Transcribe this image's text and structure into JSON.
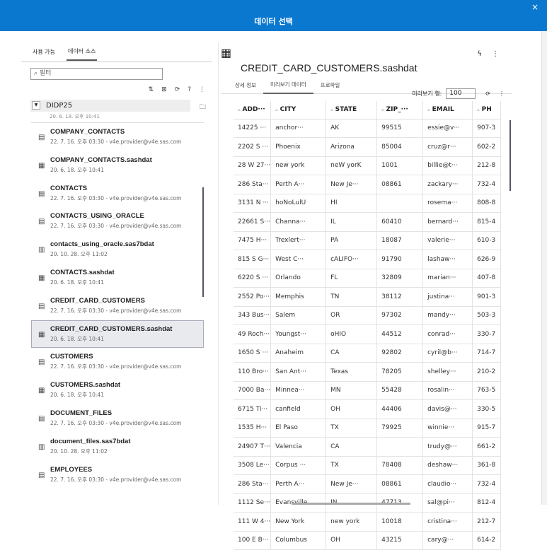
{
  "dialog": {
    "title": "데이터 선택",
    "close": "×"
  },
  "left": {
    "tabs": [
      "사용 가능",
      "데이터 소스"
    ],
    "filter_placeholder": "⌕ 필터",
    "tool_icons": [
      "⇅",
      "⊠",
      "⟳",
      "?",
      "⋮"
    ],
    "library": "DIDP25",
    "cut_item": "20. 6. 18. 오후 10:41",
    "items": [
      {
        "name": "COMPANY_CONTACTS",
        "sub": "22. 7. 16. 오후 03:30 - v4e.provider@v4e.sas.com",
        "icon": "table"
      },
      {
        "name": "COMPANY_CONTACTS.sashdat",
        "sub": "20. 6. 18. 오후 10:41",
        "icon": "file"
      },
      {
        "name": "CONTACTS",
        "sub": "22. 7. 16. 오후 03:30 - v4e.provider@v4e.sas.com",
        "icon": "table"
      },
      {
        "name": "CONTACTS_USING_ORACLE",
        "sub": "22. 7. 16. 오후 03:30 - v4e.provider@v4e.sas.com",
        "icon": "table"
      },
      {
        "name": "contacts_using_oracle.sas7bdat",
        "sub": "20. 10. 28. 오후 11:02",
        "icon": "grid"
      },
      {
        "name": "CONTACTS.sashdat",
        "sub": "20. 6. 18. 오후 10:41",
        "icon": "file"
      },
      {
        "name": "CREDIT_CARD_CUSTOMERS",
        "sub": "22. 7. 16. 오후 03:30 - v4e.provider@v4e.sas.com",
        "icon": "table"
      },
      {
        "name": "CREDIT_CARD_CUSTOMERS.sashdat",
        "sub": "20. 6. 18. 오후 10:41",
        "icon": "file"
      },
      {
        "name": "CUSTOMERS",
        "sub": "22. 7. 16. 오후 03:30 - v4e.provider@v4e.sas.com",
        "icon": "table"
      },
      {
        "name": "CUSTOMERS.sashdat",
        "sub": "20. 6. 18. 오후 10:41",
        "icon": "file"
      },
      {
        "name": "DOCUMENT_FILES",
        "sub": "22. 7. 16. 오후 03:30 - v4e.provider@v4e.sas.com",
        "icon": "table"
      },
      {
        "name": "document_files.sas7bdat",
        "sub": "20. 10. 28. 오후 11:02",
        "icon": "grid"
      },
      {
        "name": "EMPLOYEES",
        "sub": "22. 7. 16. 오후 03:30 - v4e.provider@v4e.sas.com",
        "icon": "table"
      }
    ],
    "selected_index": 7
  },
  "right": {
    "title": "CREDIT_CARD_CUSTOMERS.sashdat",
    "tabs": [
      "상세 정보",
      "미리보기 데이터",
      "프로파일"
    ],
    "active_tab": 1,
    "preview_label": "미리보기 행:",
    "preview_rows": "100",
    "columns": [
      "ADD···",
      "CITY",
      "STATE",
      "ZIP_···",
      "EMAIL",
      "PH"
    ],
    "rows": [
      [
        "14225 ···",
        "anchor···",
        "AK",
        "99515",
        "essie@v···",
        "907-3"
      ],
      [
        "2202 S ···",
        "Phoenix",
        "Arizona",
        "85004",
        "cruz@r···",
        "602-2"
      ],
      [
        "28 W 27···",
        "new york",
        "neW yorK",
        "1001",
        "billie@t···",
        "212-8"
      ],
      [
        "286 Sta···",
        "Perth A···",
        "New Je···",
        "08861",
        "zackary···",
        "732-4"
      ],
      [
        "3131 N ···",
        "hoNoLulU",
        "HI",
        "",
        "rosema···",
        "808-8"
      ],
      [
        "22661 S···",
        "Channa···",
        "IL",
        "60410",
        "bernard···",
        "815-4"
      ],
      [
        "7475 H···",
        "Trexlert···",
        "PA",
        "18087",
        "valerie···",
        "610-3"
      ],
      [
        "815 S G···",
        "West C···",
        "cALIFO···",
        "91790",
        "lashaw···",
        "626-9"
      ],
      [
        "6220 S ···",
        "Orlando",
        "FL",
        "32809",
        "marian···",
        "407-8"
      ],
      [
        "2552 Po···",
        "Memphis",
        "TN",
        "38112",
        "justina···",
        "901-3"
      ],
      [
        "343 Bus···",
        "Salem",
        "OR",
        "97302",
        "mandy···",
        "503-3"
      ],
      [
        "49 Roch···",
        "Youngst···",
        "oHIO",
        "44512",
        "conrad···",
        "330-7"
      ],
      [
        "1650 S ···",
        "Anaheim",
        "CA",
        "92802",
        "cyril@b···",
        "714-7"
      ],
      [
        "110 Bro···",
        "San Ant···",
        "Texas",
        "78205",
        "shelley···",
        "210-2"
      ],
      [
        "7000 Ba···",
        "Minnea···",
        "MN",
        "55428",
        "rosalin···",
        "763-5"
      ],
      [
        "6715 Ti···",
        "canfield",
        "OH",
        "44406",
        "davis@···",
        "330-5"
      ],
      [
        "1535 H···",
        "El Paso",
        "TX",
        "79925",
        "winnie···",
        "915-7"
      ],
      [
        "24907 T···",
        "Valencia",
        "CA",
        "",
        "trudy@···",
        "661-2"
      ],
      [
        "3508 Le···",
        "Corpus ···",
        "TX",
        "78408",
        "deshaw···",
        "361-8"
      ],
      [
        "286 Sta···",
        "Perth A···",
        "New Je···",
        "08861",
        "claudio···",
        "732-4"
      ],
      [
        "1112 Se···",
        "Evansville",
        "IN",
        "47713",
        "sal@pi···",
        "812-4"
      ],
      [
        "111 W 4···",
        "New York",
        "new york",
        "10018",
        "cristina···",
        "212-7"
      ],
      [
        "100 E B···",
        "Columbus",
        "OH",
        "43215",
        "cary@···",
        "614-2"
      ]
    ]
  },
  "colors": {
    "brand": "#0b78d0"
  }
}
